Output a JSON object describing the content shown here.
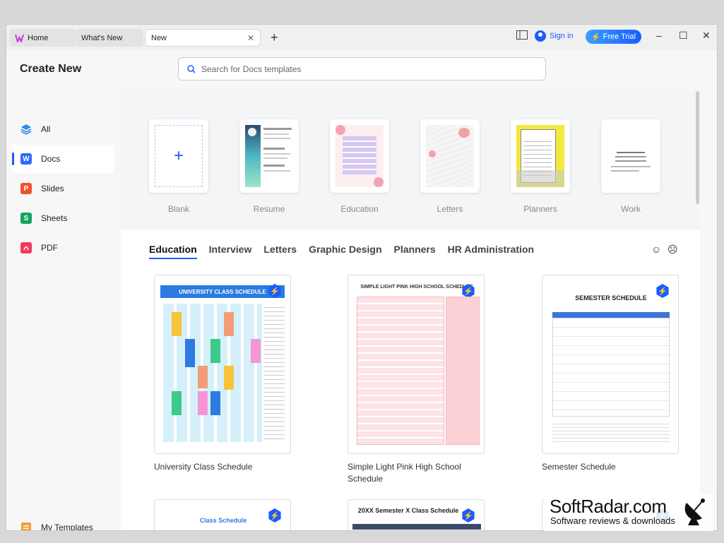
{
  "titlebar": {
    "tabs": [
      {
        "label": "Home"
      },
      {
        "label": "What's New"
      },
      {
        "label": "New"
      }
    ],
    "new_tab_symbol": "+",
    "close_symbol": "✕",
    "sign_in": "Sign in",
    "free_trial": "Free Trial",
    "window_controls": [
      "–",
      "☐",
      "✕"
    ]
  },
  "sidebar": {
    "title": "Create New",
    "items": [
      {
        "label": "All",
        "icon": "layers-icon",
        "color": "#2a8cf0"
      },
      {
        "label": "Docs",
        "icon": "W",
        "color": "#2e6cf6"
      },
      {
        "label": "Slides",
        "icon": "P",
        "color": "#f0502e"
      },
      {
        "label": "Sheets",
        "icon": "S",
        "color": "#15a35b"
      },
      {
        "label": "PDF",
        "icon": "pdf-icon",
        "color": "#f23b57"
      }
    ],
    "my_templates": "My Templates"
  },
  "search": {
    "placeholder": "Search for Docs templates"
  },
  "recent_templates": [
    {
      "label": "Blank"
    },
    {
      "label": "Resume"
    },
    {
      "label": "Education"
    },
    {
      "label": "Letters"
    },
    {
      "label": "Planners"
    },
    {
      "label": "Work"
    }
  ],
  "category_tabs": [
    {
      "label": "Education",
      "active": true
    },
    {
      "label": "Interview"
    },
    {
      "label": "Letters"
    },
    {
      "label": "Graphic Design"
    },
    {
      "label": "Planners"
    },
    {
      "label": "HR Administration"
    }
  ],
  "feedback": {
    "happy": "☺",
    "sad": "☹"
  },
  "template_cards": [
    {
      "title": "University Class Schedule",
      "thumb_header": "UNIVERSITY CLASS SCHEDULE"
    },
    {
      "title": "Simple Light Pink High School Schedule",
      "thumb_header": "SIMPLE LIGHT PINK HIGH SCHOOL SCHEDULE"
    },
    {
      "title": "Semester Schedule",
      "thumb_header": "SEMESTER SCHEDULE"
    }
  ],
  "bottom_cards": [
    {
      "thumb_header": "Class Schedule"
    },
    {
      "thumb_header": "20XX Semester X Class Schedule"
    },
    {
      "thumb_header": ""
    }
  ],
  "watermark": {
    "title": "SoftRadar.com",
    "subtitle": "Software reviews & downloads"
  },
  "colors": {
    "accent": "#1a5cff",
    "main_bg": "#ffffff",
    "sidebar_bg": "#f7f7f7"
  }
}
